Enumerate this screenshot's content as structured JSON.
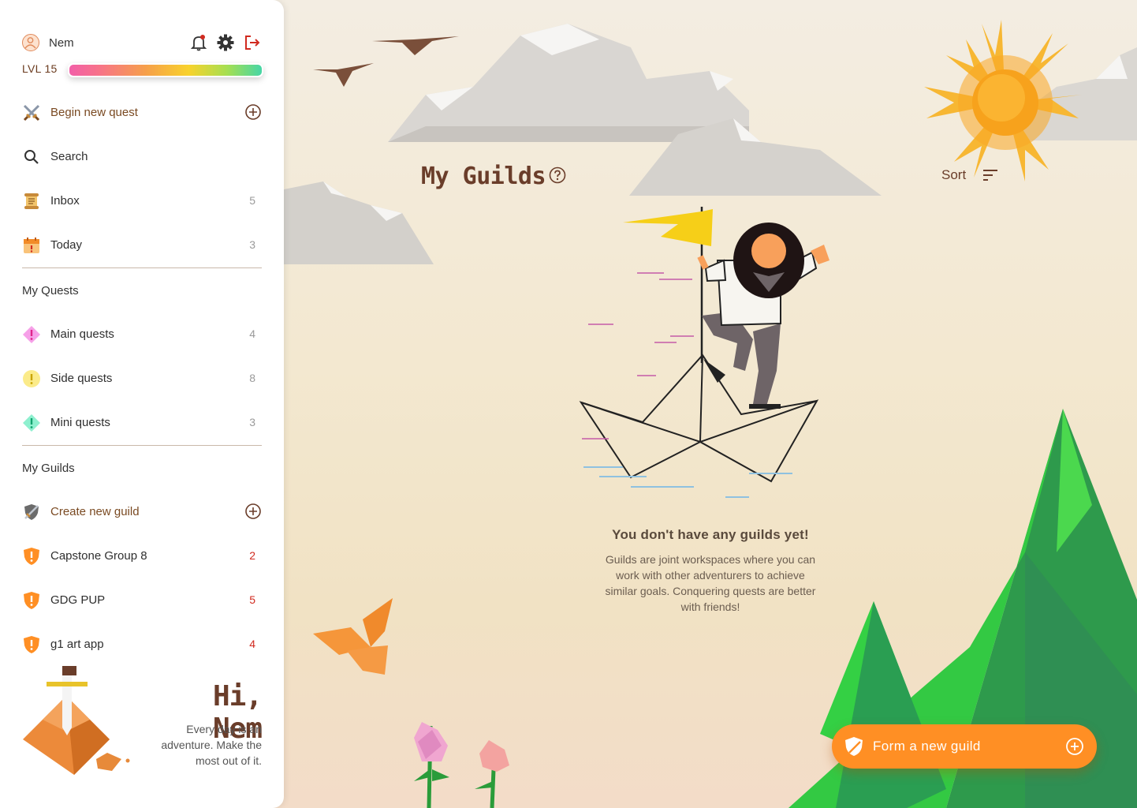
{
  "user": {
    "name": "Nem",
    "level": "LVL 15",
    "xp_fraction": 1.0
  },
  "nav": {
    "begin_quest": "Begin new quest",
    "search": "Search",
    "inbox": {
      "label": "Inbox",
      "count": "5"
    },
    "today": {
      "label": "Today",
      "count": "3"
    }
  },
  "my_quests": {
    "heading": "My Quests",
    "items": [
      {
        "label": "Main quests",
        "count": "4",
        "color": "#f27de0"
      },
      {
        "label": "Side quests",
        "count": "8",
        "color": "#f7e04a"
      },
      {
        "label": "Mini quests",
        "count": "3",
        "color": "#4fe0b5"
      }
    ]
  },
  "my_guilds": {
    "heading": "My Guilds",
    "create": "Create new guild",
    "items": [
      {
        "label": "Capstone Group 8",
        "count": "2"
      },
      {
        "label": "GDG PUP",
        "count": "5"
      },
      {
        "label": "g1 art app",
        "count": "4"
      }
    ]
  },
  "greeting": {
    "title": "Hi, Nem",
    "tagline": "Every day is an adventure. Make the most out of it."
  },
  "main": {
    "title": "My Guilds",
    "sort_label": "Sort",
    "empty_title": "You don't have any guilds yet!",
    "empty_body": "Guilds are joint workspaces where you can work with other adventurers to achieve similar goals. Conquering quests are better with friends!",
    "cta": "Form a new guild"
  },
  "colors": {
    "accent": "#ff8f24",
    "brown": "#6a3d2a",
    "count_red": "#d12a1f"
  }
}
